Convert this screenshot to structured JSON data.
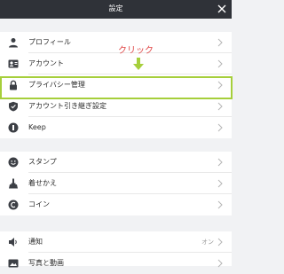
{
  "header": {
    "title": "設定",
    "close_icon": "close-icon"
  },
  "group1": {
    "items": [
      {
        "label": "プロフィール",
        "icon": "person-icon"
      },
      {
        "label": "アカウント",
        "icon": "id-card-icon"
      },
      {
        "label": "プライバシー管理",
        "icon": "lock-icon"
      },
      {
        "label": "アカウント引き継ぎ設定",
        "icon": "shield-icon"
      },
      {
        "label": "Keep",
        "icon": "keep-icon"
      }
    ]
  },
  "group2": {
    "items": [
      {
        "label": "スタンプ",
        "icon": "smiley-icon"
      },
      {
        "label": "着せかえ",
        "icon": "brush-icon"
      },
      {
        "label": "コイン",
        "icon": "coin-icon"
      }
    ]
  },
  "group3": {
    "items": [
      {
        "label": "通知",
        "value": "オン",
        "icon": "speaker-icon"
      },
      {
        "label": "写真と動画",
        "icon": "photo-icon"
      }
    ]
  },
  "annotation": {
    "text": "クリック",
    "color": "#e04848",
    "arrow_color": "#a6cf3b"
  },
  "colors": {
    "header_bg": "#2f3238",
    "highlight": "#a6cf3b"
  }
}
